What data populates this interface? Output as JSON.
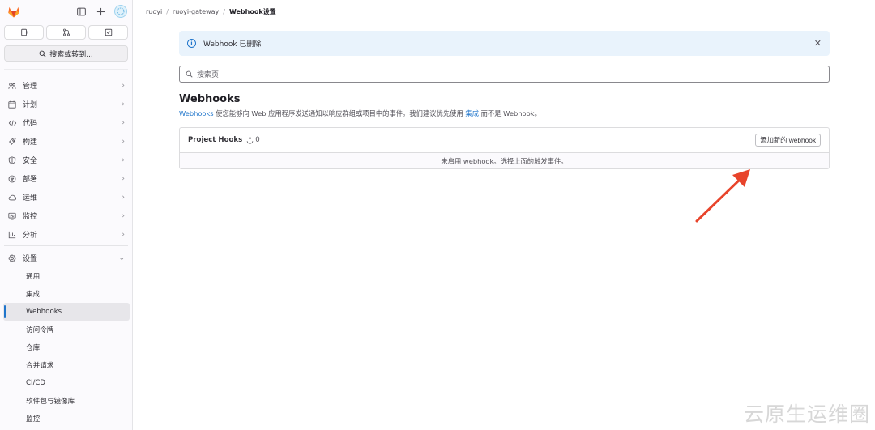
{
  "breadcrumb": [
    "ruoyi",
    "ruoyi-gateway",
    "Webhook设置"
  ],
  "sidebar": {
    "search_label": "搜索或转到...",
    "nav": [
      {
        "label": "管理",
        "icon": "users-icon"
      },
      {
        "label": "计划",
        "icon": "calendar-icon"
      },
      {
        "label": "代码",
        "icon": "code-icon"
      },
      {
        "label": "构建",
        "icon": "rocket-icon"
      },
      {
        "label": "安全",
        "icon": "shield-icon"
      },
      {
        "label": "部署",
        "icon": "deploy-icon"
      },
      {
        "label": "运维",
        "icon": "cloud-icon"
      },
      {
        "label": "监控",
        "icon": "monitor-icon"
      },
      {
        "label": "分析",
        "icon": "chart-icon"
      }
    ],
    "settings_label": "设置",
    "sub": [
      "通用",
      "集成",
      "Webhooks",
      "访问令牌",
      "仓库",
      "合并请求",
      "CI/CD",
      "软件包与镜像库",
      "监控"
    ]
  },
  "alert": {
    "text": "Webhook 已删除"
  },
  "search": {
    "placeholder": "搜索页"
  },
  "page": {
    "title": "Webhooks",
    "desc_link": "Webhooks",
    "desc_text": " 使您能够向 Web 应用程序发送通知以响应群组或项目中的事件。我们建议优先使用 ",
    "desc_link2": "集成",
    "desc_tail": " 而不是 Webhook。"
  },
  "hooks": {
    "title": "Project Hooks",
    "count": "0",
    "add_label": "添加新的 webhook",
    "empty_text": "未启用 webhook。选择上面的触发事件。"
  },
  "watermark": "云原生运维圈",
  "colors": {
    "accent": "#1f75cb",
    "arrow": "#e8442b",
    "alert_bg": "#e9f3fc"
  }
}
